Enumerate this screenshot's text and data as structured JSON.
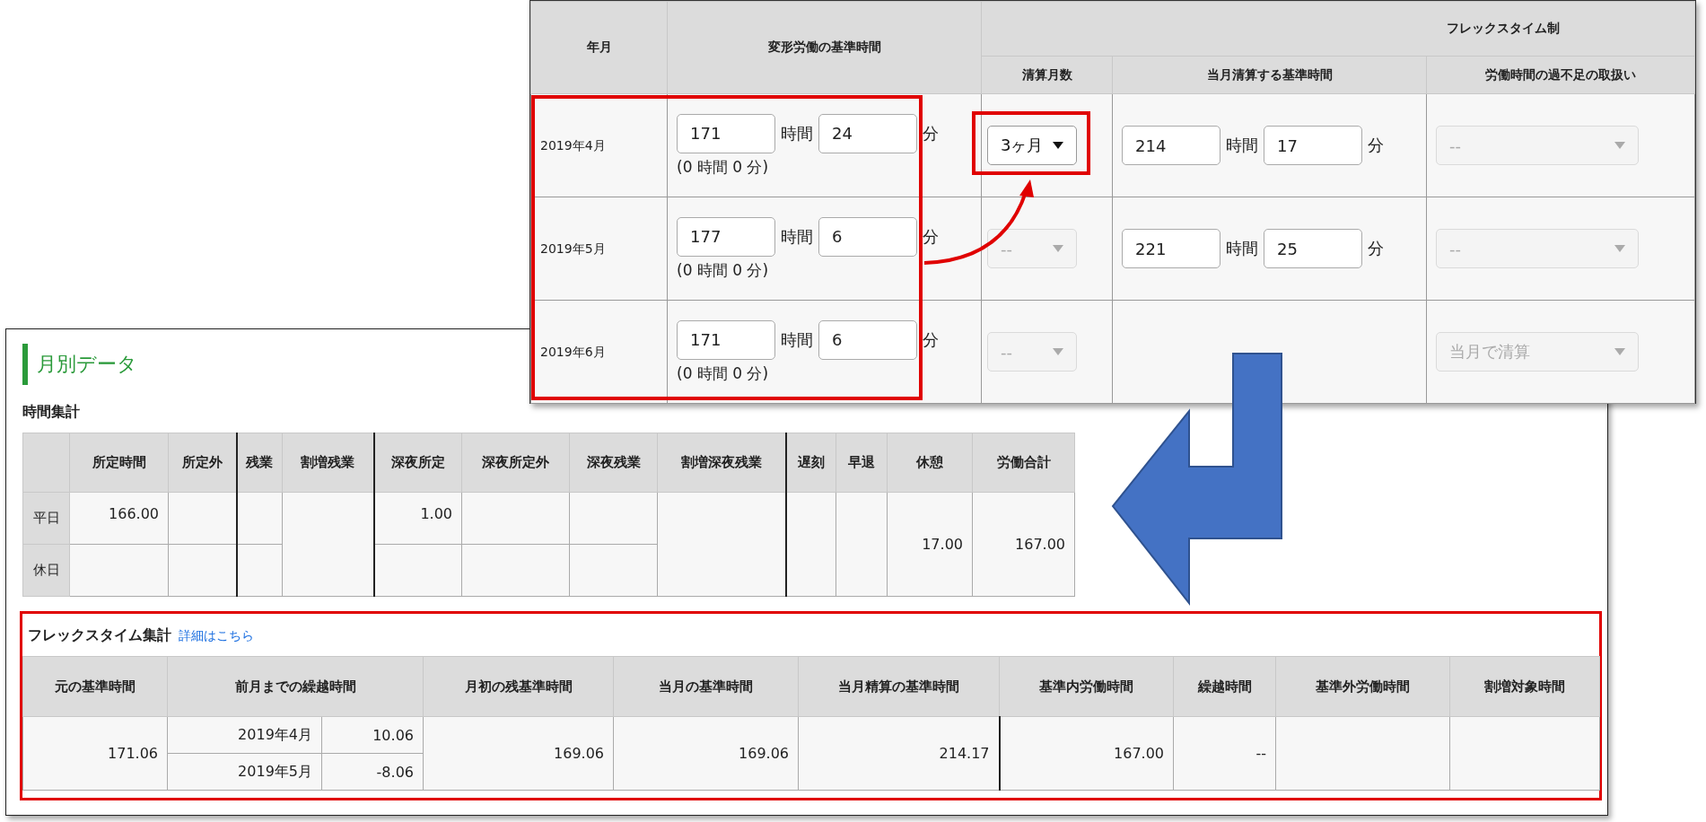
{
  "schedule": {
    "headers": {
      "month": "年月",
      "base_time": "変形労働の基準時間",
      "flex_group": "フレックスタイム制",
      "settlement_months": "清算月数",
      "settlement_base": "当月清算する基準時間",
      "shortage_handling": "労働時間の過不足の取扱い"
    },
    "rows": [
      {
        "month": "2019年4月",
        "hours": "171",
        "hours_unit": "時間",
        "minutes": "24",
        "minutes_unit": "分",
        "note": "(0 時間 0 分)",
        "settlement": {
          "value": "3ヶ月",
          "disabled": false
        },
        "base": {
          "hours": "214",
          "hours_unit": "時間",
          "minutes": "17",
          "minutes_unit": "分"
        },
        "handling": {
          "value": "--",
          "disabled": true
        }
      },
      {
        "month": "2019年5月",
        "hours": "177",
        "hours_unit": "時間",
        "minutes": "6",
        "minutes_unit": "分",
        "note": "(0 時間 0 分)",
        "settlement": {
          "value": "--",
          "disabled": true
        },
        "base": {
          "hours": "221",
          "hours_unit": "時間",
          "minutes": "25",
          "minutes_unit": "分"
        },
        "handling": {
          "value": "--",
          "disabled": true
        }
      },
      {
        "month": "2019年6月",
        "hours": "171",
        "hours_unit": "時間",
        "minutes": "6",
        "minutes_unit": "分",
        "note": "(0 時間 0 分)",
        "settlement": {
          "value": "--",
          "disabled": true
        },
        "handling": {
          "value": "当月で清算",
          "disabled": true
        }
      }
    ]
  },
  "monthly": {
    "title": "月別データ",
    "time_summary": {
      "title": "時間集計",
      "row_labels": [
        "平日",
        "休日"
      ],
      "columns": [
        {
          "label": "所定時間",
          "kind": "split",
          "weekday": "166.00"
        },
        {
          "label": "所定外",
          "kind": "split"
        },
        {
          "label": "残業",
          "kind": "split"
        },
        {
          "label": "割増残業",
          "kind": "merged"
        },
        {
          "label": "深夜所定",
          "kind": "split",
          "weekday": "1.00"
        },
        {
          "label": "深夜所定外",
          "kind": "split"
        },
        {
          "label": "深夜残業",
          "kind": "split"
        },
        {
          "label": "割増深夜残業",
          "kind": "merged"
        },
        {
          "label": "遅刻",
          "kind": "merged"
        },
        {
          "label": "早退",
          "kind": "merged"
        },
        {
          "label": "休憩",
          "kind": "merged",
          "value": "17.00"
        },
        {
          "label": "労働合計",
          "kind": "merged",
          "value": "167.00"
        }
      ]
    },
    "flex_summary": {
      "title": "フレックスタイム集計",
      "link": "詳細はこちら",
      "columns": [
        "元の基準時間",
        "前月までの繰越時間",
        "月初の残基準時間",
        "当月の基準時間",
        "当月精算の基準時間",
        "基準内労働時間",
        "繰越時間",
        "基準外労働時間",
        "割増対象時間"
      ],
      "original_base": "171.06",
      "carryover": [
        {
          "month": "2019年4月",
          "value": "10.06"
        },
        {
          "month": "2019年5月",
          "value": "-8.06"
        }
      ],
      "values": [
        "169.06",
        "169.06",
        "214.17",
        "167.00",
        "--"
      ]
    }
  }
}
